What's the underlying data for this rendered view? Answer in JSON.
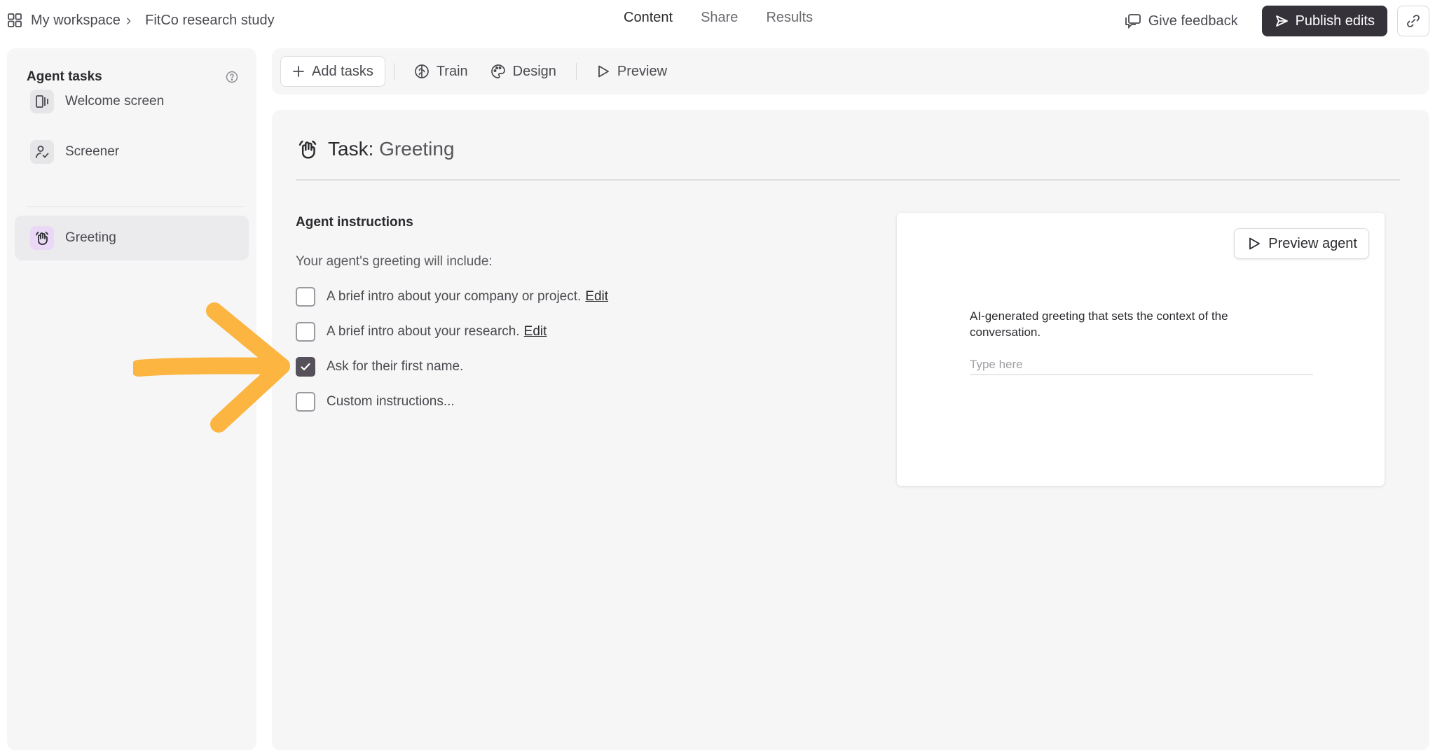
{
  "breadcrumb": {
    "workspace": "My workspace",
    "separator": "›",
    "study": "FitCo research study"
  },
  "top_tabs": [
    {
      "label": "Content",
      "active": true
    },
    {
      "label": "Share",
      "active": false
    },
    {
      "label": "Results",
      "active": false
    }
  ],
  "header_actions": {
    "feedback_label": "Give feedback",
    "publish_label": "Publish edits"
  },
  "sidebar": {
    "title": "Agent tasks",
    "items": [
      {
        "label": "Welcome screen",
        "icon": "welcome-screen-icon"
      },
      {
        "label": "Screener",
        "icon": "screener-icon"
      },
      {
        "label": "Greeting",
        "icon": "wave-hand-icon",
        "selected": true
      }
    ]
  },
  "toolbar": {
    "add_label": "Add tasks",
    "train_label": "Train",
    "design_label": "Design",
    "preview_label": "Preview"
  },
  "task": {
    "prefix": "Task:",
    "name": "Greeting",
    "section_title": "Agent instructions",
    "intro": "Your agent's greeting will include:",
    "options": [
      {
        "label": "A brief intro about your company or project.",
        "edit": "Edit",
        "checked": false
      },
      {
        "label": "A brief intro about your research.",
        "edit": "Edit",
        "checked": false
      },
      {
        "label": "Ask for their first name.",
        "checked": true
      },
      {
        "label": "Custom instructions...",
        "checked": false
      }
    ]
  },
  "preview": {
    "button_label": "Preview agent",
    "description": "AI-generated greeting that sets the context of the conversation.",
    "input_value": "",
    "input_placeholder": "Type here"
  },
  "colors": {
    "accent_dark": "#36323a",
    "greeting_icon_bg": "#ead8f6",
    "annotation_arrow": "#fbb540"
  }
}
